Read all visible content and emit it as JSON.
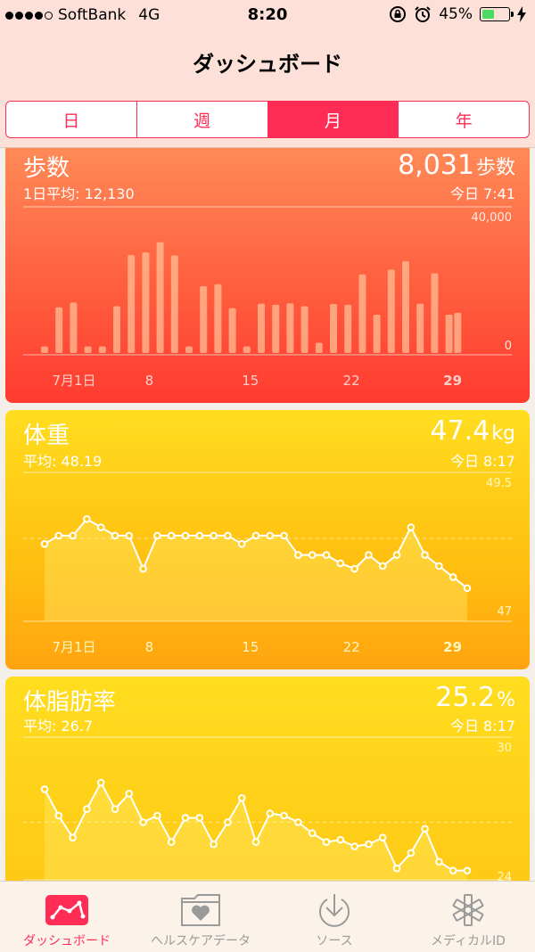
{
  "status_bar": {
    "carrier": "SoftBank",
    "network": "4G",
    "time": "8:20",
    "battery_percent": "45%",
    "battery_level": 0.45,
    "signal_bars_filled": 4,
    "signal_bars_total": 5
  },
  "nav": {
    "title": "ダッシュボード",
    "segments": [
      "日",
      "週",
      "月",
      "年"
    ],
    "active_segment": "月"
  },
  "cards": {
    "steps": {
      "title": "歩数",
      "subtitle": "1日平均: 12,130",
      "value": "8,031",
      "unit": "歩数",
      "time": "今日 7:41",
      "ymax_label": "40,000",
      "ymin_label": "0"
    },
    "weight": {
      "title": "体重",
      "subtitle": "平均: 48.19",
      "value": "47.4",
      "unit": "kg",
      "time": "今日 8:17",
      "ymax_label": "49.5",
      "ymin_label": "47"
    },
    "fat": {
      "title": "体脂肪率",
      "subtitle": "平均: 26.7",
      "value": "25.2",
      "unit": "%",
      "time": "今日 8:17",
      "ymax_label": "30",
      "ymin_label": "24"
    }
  },
  "x_ticks": [
    {
      "label": "7月1日",
      "day": 1
    },
    {
      "label": "8",
      "day": 8
    },
    {
      "label": "15",
      "day": 15
    },
    {
      "label": "22",
      "day": 22
    },
    {
      "label": "29",
      "day": 29,
      "bold": true
    }
  ],
  "chart_data": [
    {
      "type": "bar",
      "title": "歩数",
      "x": [
        1,
        2,
        3,
        4,
        5,
        6,
        7,
        8,
        9,
        10,
        11,
        12,
        13,
        14,
        15,
        16,
        17,
        18,
        19,
        20,
        21,
        22,
        23,
        24,
        25,
        26,
        27,
        28,
        29
      ],
      "values": [
        1800,
        12500,
        13800,
        1800,
        1800,
        12800,
        26800,
        27500,
        30300,
        26700,
        1800,
        18300,
        18800,
        12300,
        1800,
        13500,
        13200,
        13600,
        12800,
        2800,
        13400,
        13200,
        21500,
        10500,
        22800,
        25100,
        13500,
        21800,
        10500
      ],
      "extra_bar": {
        "x": 29.6,
        "value": 11000
      },
      "today_value": 9400,
      "ylim": [
        0,
        40000
      ]
    },
    {
      "type": "line",
      "title": "体重",
      "x": [
        1,
        2,
        3,
        4,
        5,
        6,
        7,
        8,
        9,
        10,
        11,
        12,
        13,
        14,
        15,
        16,
        17,
        18,
        19,
        20,
        21,
        22,
        23,
        24,
        25,
        26,
        27,
        28,
        29
      ],
      "values": [
        48.4,
        48.55,
        48.55,
        48.85,
        48.7,
        48.55,
        48.55,
        47.95,
        48.55,
        48.55,
        48.55,
        48.55,
        48.55,
        48.55,
        48.4,
        48.55,
        48.55,
        48.55,
        48.2,
        48.2,
        48.2,
        48.05,
        47.95,
        48.2,
        48.0,
        48.2,
        48.7,
        48.2,
        48.0,
        47.8,
        47.6
      ],
      "ylim": [
        47,
        49.5
      ],
      "reference_line": 48.5
    },
    {
      "type": "line",
      "title": "体脂肪率",
      "x": [
        1,
        2,
        3,
        4,
        5,
        6,
        7,
        8,
        9,
        10,
        11,
        12,
        13,
        14,
        15,
        16,
        17,
        18,
        19,
        20,
        21,
        22,
        23,
        24,
        25,
        26,
        27,
        28,
        29
      ],
      "values": [
        28.2,
        27.0,
        26.0,
        27.3,
        28.5,
        27.3,
        28.0,
        26.7,
        27.0,
        25.8,
        26.9,
        26.9,
        25.7,
        26.7,
        27.8,
        25.8,
        27.1,
        27.0,
        26.7,
        26.2,
        25.8,
        25.9,
        25.6,
        25.7,
        26.0,
        24.6,
        25.3,
        26.4,
        24.9,
        24.5,
        24.5
      ],
      "ylim": [
        24,
        30
      ],
      "reference_line": 26.7
    }
  ],
  "tabs": [
    {
      "label": "ダッシュボード",
      "icon": "chart-line-icon",
      "active": true
    },
    {
      "label": "ヘルスケアデータ",
      "icon": "folder-heart-icon",
      "active": false
    },
    {
      "label": "ソース",
      "icon": "download-arrow-icon",
      "active": false
    },
    {
      "label": "メディカルID",
      "icon": "medical-star-icon",
      "active": false
    }
  ],
  "colors": {
    "accent": "#ff2d55",
    "steps_top": "#ff8a57",
    "steps_bottom": "#ff3b30",
    "yellow_top": "#ffdd1f",
    "yellow_bottom": "#ffa410"
  }
}
